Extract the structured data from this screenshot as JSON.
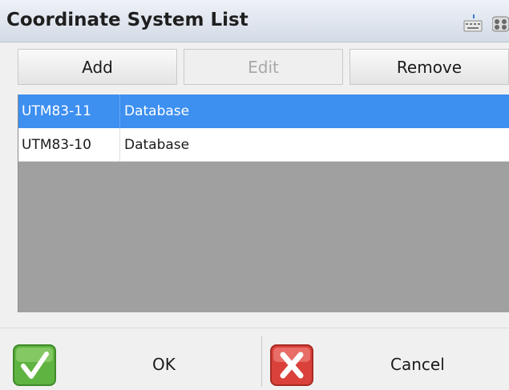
{
  "window": {
    "title": "Coordinate System List"
  },
  "toolbar": {
    "add_label": "Add",
    "edit_label": "Edit",
    "remove_label": "Remove"
  },
  "list": {
    "rows": [
      {
        "name": "UTM83-11",
        "source": "Database",
        "selected": true
      },
      {
        "name": "UTM83-10",
        "source": "Database",
        "selected": false
      }
    ]
  },
  "footer": {
    "ok_label": "OK",
    "cancel_label": "Cancel"
  },
  "colors": {
    "selection": "#3d8ff0",
    "list_background": "#a0a0a0"
  }
}
